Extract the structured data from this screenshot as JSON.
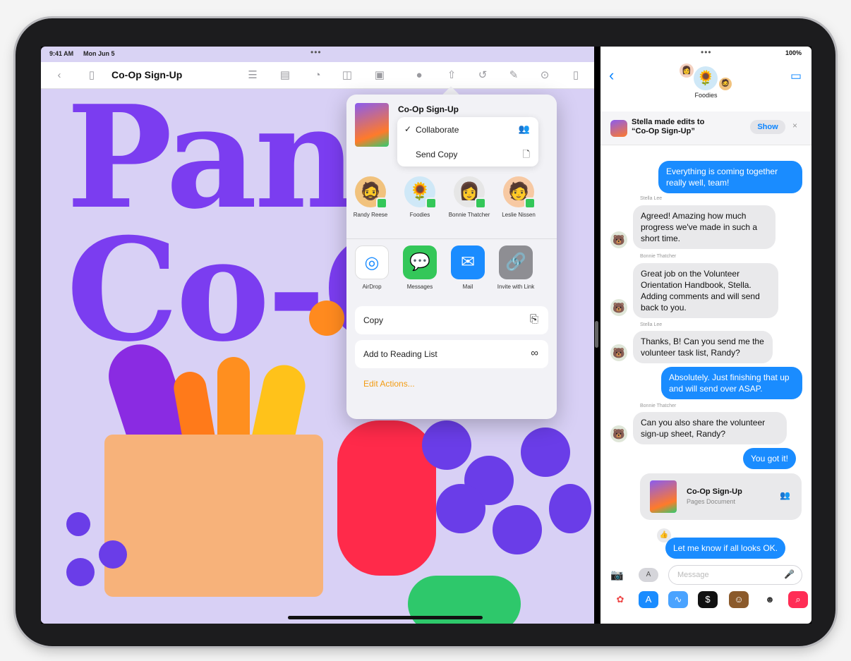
{
  "pages_app": {
    "status": {
      "time": "9:41 AM",
      "date": "Mon Jun 5"
    },
    "toolbar": {
      "title": "Co-Op Sign-Up"
    },
    "canvas": {
      "headline_1": "Pan",
      "headline_2": "Co-O"
    },
    "share_sheet": {
      "doc_title": "Co-Op Sign-Up",
      "mode_options": [
        {
          "label": "Collaborate",
          "selected": true,
          "icon": "people-icon"
        },
        {
          "label": "Send Copy",
          "selected": false,
          "icon": "document-icon"
        }
      ],
      "people": [
        {
          "name": "Randy Reese",
          "icon": "memoji-icon"
        },
        {
          "name": "Foodies",
          "icon": "sunflower-icon"
        },
        {
          "name": "Bonnie Thatcher",
          "icon": "memoji-icon"
        },
        {
          "name": "Leslie Nissen",
          "icon": "memoji-icon"
        }
      ],
      "apps": [
        {
          "name": "AirDrop",
          "icon": "airdrop-icon",
          "color": "#ffffff"
        },
        {
          "name": "Messages",
          "icon": "messages-icon",
          "color": "#34c759"
        },
        {
          "name": "Mail",
          "icon": "mail-icon",
          "color": "#1a8cff"
        },
        {
          "name": "Invite with Link",
          "icon": "link-icon",
          "color": "#8e8e93"
        }
      ],
      "actions": [
        {
          "label": "Copy",
          "icon": "copy-icon"
        },
        {
          "label": "Add to Reading List",
          "icon": "glasses-icon"
        }
      ],
      "edit_actions": "Edit Actions..."
    }
  },
  "messages_app": {
    "status": {
      "battery": "100%"
    },
    "group_name": "Foodies",
    "banner": {
      "line1": "Stella made edits to",
      "line2": "“Co-Op Sign-Up”",
      "show_label": "Show"
    },
    "messages": [
      {
        "dir": "out",
        "text": "Everything is coming together really well, team!"
      },
      {
        "dir": "in",
        "sender": "Stella Lee",
        "text": "Agreed! Amazing how much progress we've made in such a short time."
      },
      {
        "dir": "in",
        "sender": "Bonnie Thatcher",
        "text": "Great job on the Volunteer Orientation Handbook, Stella. Adding comments and will send back to you."
      },
      {
        "dir": "in",
        "sender": "Stella Lee",
        "text": "Thanks, B! Can you send me the volunteer task list, Randy?"
      },
      {
        "dir": "out",
        "text": "Absolutely. Just finishing that up and will send over ASAP."
      },
      {
        "dir": "in",
        "sender": "Bonnie Thatcher",
        "text": "Can you also share the volunteer sign-up sheet, Randy?"
      },
      {
        "dir": "out",
        "text": "You got it!"
      },
      {
        "dir": "out",
        "text": "Let me know if all looks OK."
      }
    ],
    "link_card": {
      "title": "Co-Op Sign-Up",
      "subtitle": "Pages Document"
    },
    "composer": {
      "placeholder": "Message"
    },
    "colors": {
      "accent": "#0a84ff",
      "bubble_out": "#1a8cff",
      "bubble_in": "#e9e9eb"
    }
  }
}
